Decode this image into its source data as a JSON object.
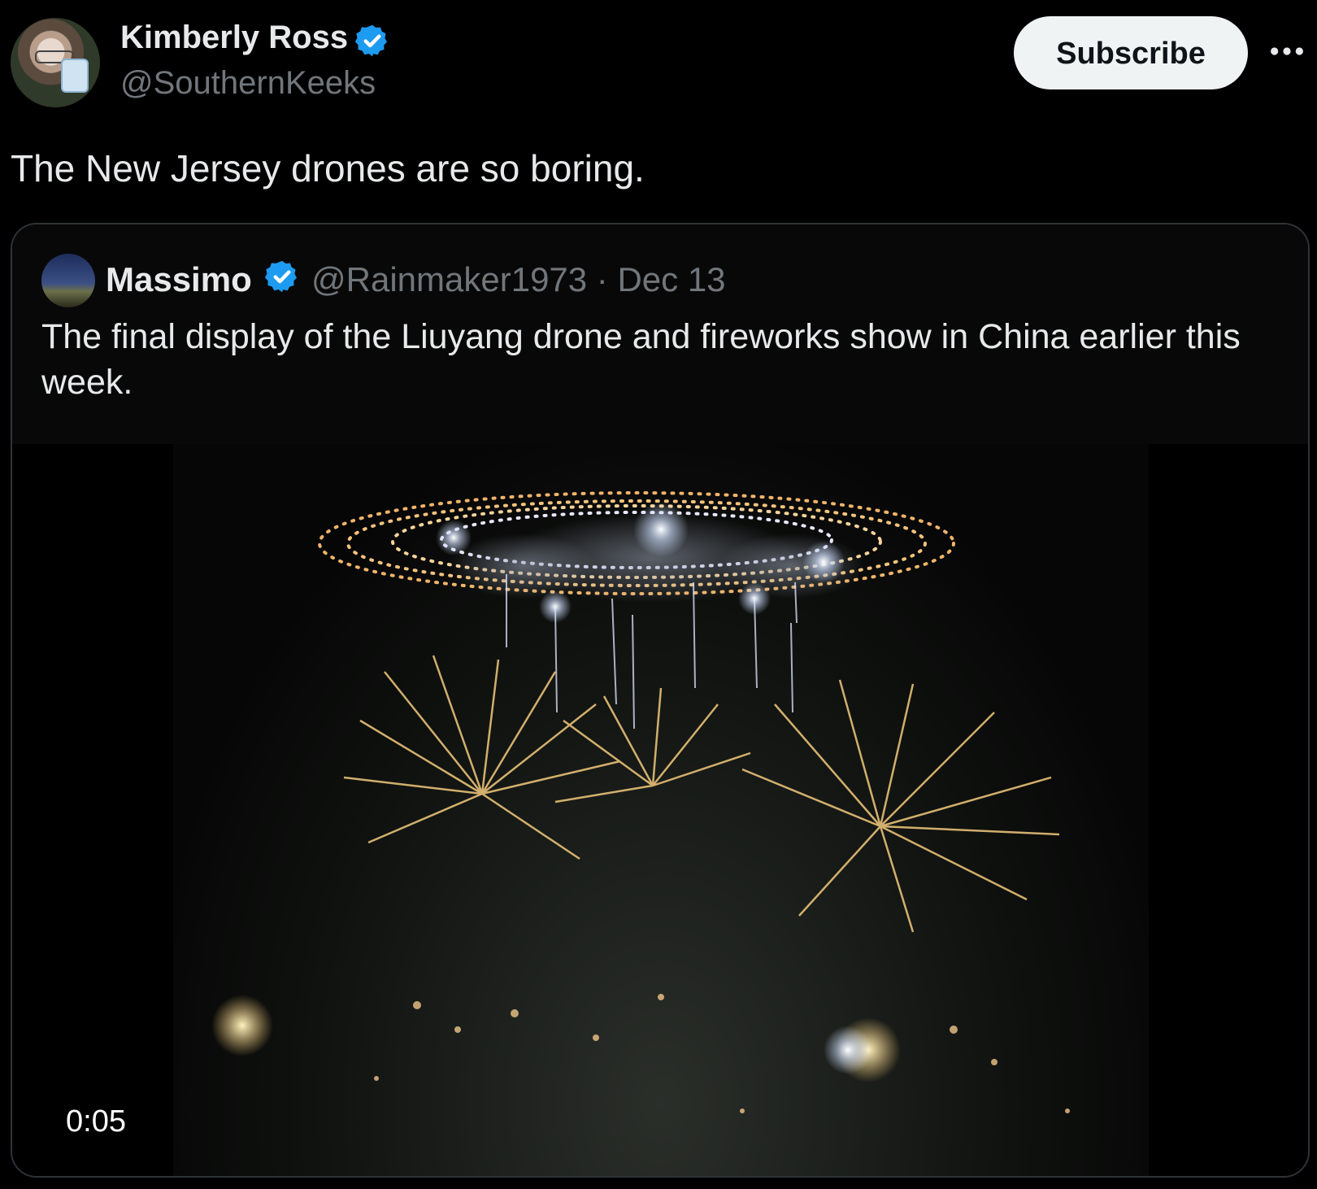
{
  "author": {
    "name": "Kimberly Ross",
    "handle": "@SouthernKeeks",
    "subscribe_label": "Subscribe"
  },
  "tweet": {
    "text": "The New Jersey drones are so boring."
  },
  "quoted": {
    "name": "Massimo",
    "handle_date": "@Rainmaker1973 · Dec 13",
    "text": "The final display of the Liuyang drone and fireworks show in China earlier this week.",
    "video_time": "0:05"
  },
  "colors": {
    "background": "#000000",
    "verified_badge": "#1d9bf0",
    "secondary_text": "#71767b",
    "primary_text": "#e7e9ea"
  },
  "icons": [
    "verified-badge-icon",
    "more-options-icon"
  ]
}
